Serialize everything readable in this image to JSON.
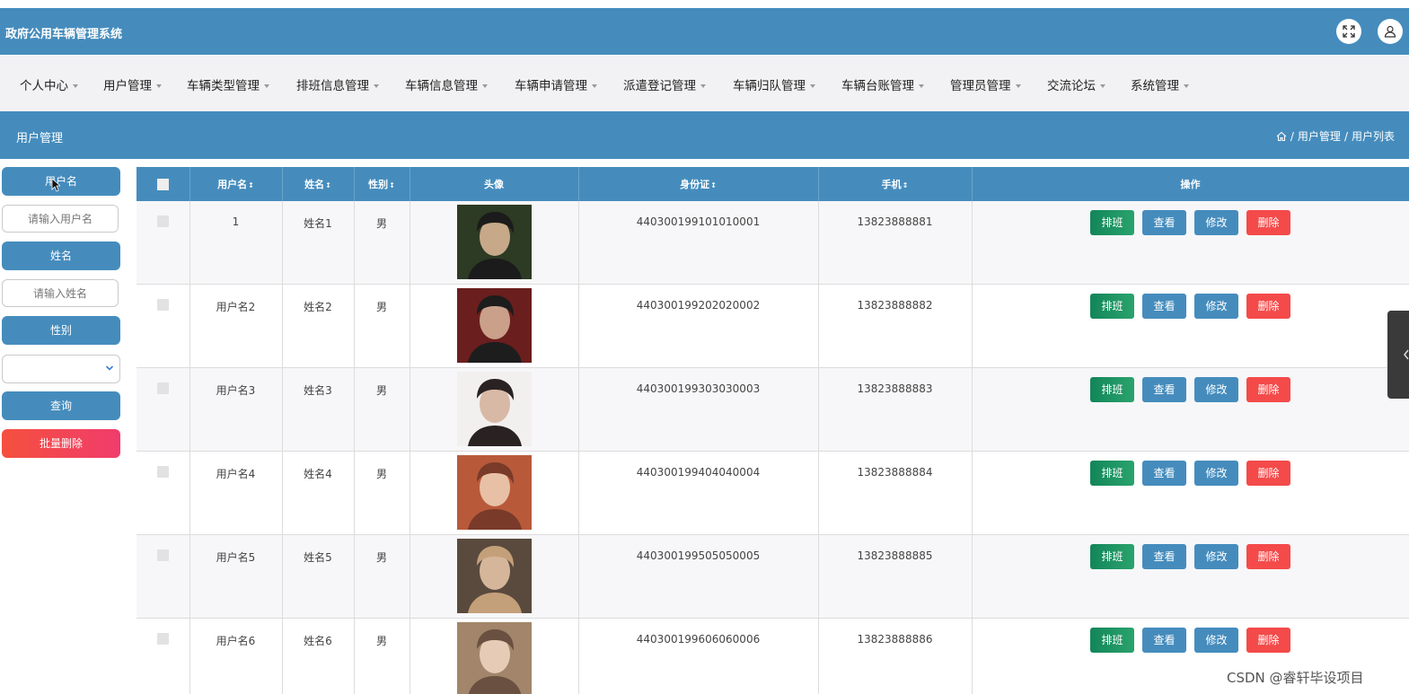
{
  "app": {
    "title": "政府公用车辆管理系统"
  },
  "nav": {
    "items": [
      "个人中心",
      "用户管理",
      "车辆类型管理",
      "排班信息管理",
      "车辆信息管理",
      "车辆申请管理",
      "派遣登记管理",
      "车辆归队管理",
      "车辆台账管理",
      "管理员管理",
      "交流论坛",
      "系统管理"
    ]
  },
  "page": {
    "title": "用户管理",
    "breadcrumb": [
      "用户管理",
      "用户列表"
    ]
  },
  "search": {
    "username_label": "用户名",
    "username_placeholder": "请输入用户名",
    "name_label": "姓名",
    "name_placeholder": "请输入姓名",
    "gender_label": "性别",
    "gender_value": "",
    "query_button": "查询",
    "batch_delete_button": "批量删除"
  },
  "table": {
    "headers": {
      "username": "用户名",
      "name": "姓名",
      "gender": "性别",
      "avatar": "头像",
      "id_card": "身份证",
      "phone": "手机",
      "actions": "操作"
    },
    "action_labels": {
      "schedule": "排班",
      "view": "查看",
      "edit": "修改",
      "delete": "删除"
    },
    "rows": [
      {
        "username": "1",
        "name": "姓名1",
        "gender": "男",
        "id_card": "440300199101010001",
        "phone": "13823888881"
      },
      {
        "username": "用户名2",
        "name": "姓名2",
        "gender": "男",
        "id_card": "440300199202020002",
        "phone": "13823888882"
      },
      {
        "username": "用户名3",
        "name": "姓名3",
        "gender": "男",
        "id_card": "440300199303030003",
        "phone": "13823888883"
      },
      {
        "username": "用户名4",
        "name": "姓名4",
        "gender": "男",
        "id_card": "440300199404040004",
        "phone": "13823888884"
      },
      {
        "username": "用户名5",
        "name": "姓名5",
        "gender": "男",
        "id_card": "440300199505050005",
        "phone": "13823888885"
      },
      {
        "username": "用户名6",
        "name": "姓名6",
        "gender": "男",
        "id_card": "440300199606060006",
        "phone": "13823888886"
      }
    ]
  },
  "watermark": "CSDN @睿轩毕设项目",
  "colors": {
    "primary": "#458cbd",
    "schedule_button": "#1a8f5c",
    "view_button": "#458cbd",
    "edit_button": "#458cbd",
    "delete_button": "#f44a4a",
    "batch_delete": "#f5475a"
  }
}
